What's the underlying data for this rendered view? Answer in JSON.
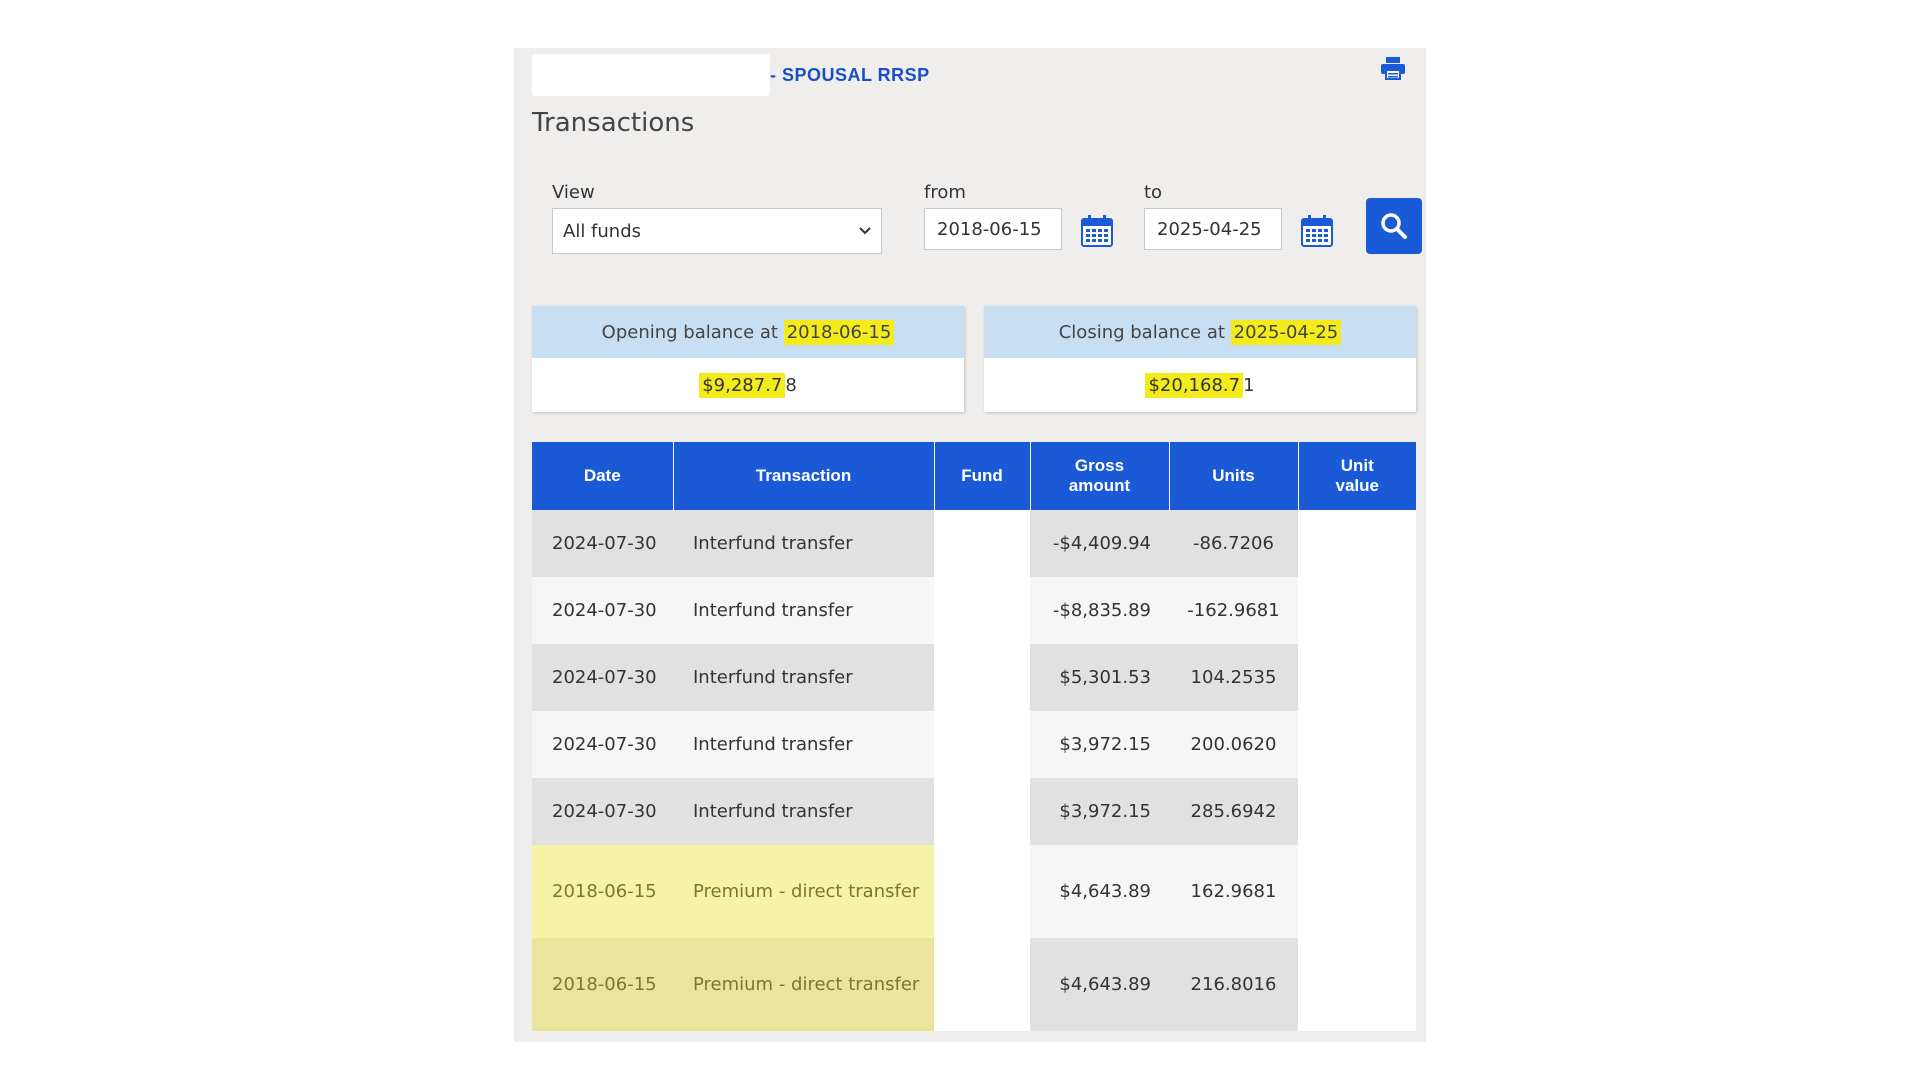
{
  "account": {
    "type_label": "- SPOUSAL RRSP"
  },
  "page": {
    "title": "Transactions"
  },
  "filters": {
    "view_label": "View",
    "view_value": "All funds",
    "from_label": "from",
    "from_value": "2018-06-15",
    "to_label": "to",
    "to_value": "2025-04-25"
  },
  "balances": {
    "opening": {
      "label": "Opening balance at ",
      "date": "2018-06-15",
      "amount_highlighted": "$9,287.7",
      "amount_rest": "8"
    },
    "closing": {
      "label": "Closing balance at ",
      "date": "2025-04-25",
      "amount_highlighted": "$20,168.7",
      "amount_rest": "1"
    }
  },
  "table": {
    "headers": {
      "date": "Date",
      "transaction": "Transaction",
      "fund": "Fund",
      "gross_line1": "Gross",
      "gross_line2": "amount",
      "units": "Units",
      "unit_value_line1": "Unit",
      "unit_value_line2": "value"
    },
    "rows": [
      {
        "date": "2024-07-30",
        "transaction": "Interfund transfer",
        "gross": "-$4,409.94",
        "units": "-86.7206"
      },
      {
        "date": "2024-07-30",
        "transaction": "Interfund transfer",
        "gross": "-$8,835.89",
        "units": "-162.9681"
      },
      {
        "date": "2024-07-30",
        "transaction": "Interfund transfer",
        "gross": "$5,301.53",
        "units": "104.2535"
      },
      {
        "date": "2024-07-30",
        "transaction": "Interfund transfer",
        "gross": "$3,972.15",
        "units": "200.0620"
      },
      {
        "date": "2024-07-30",
        "transaction": "Interfund transfer",
        "gross": "$3,972.15",
        "units": "285.6942"
      },
      {
        "date": "2018-06-15",
        "transaction": "Premium - direct transfer",
        "gross": "$4,643.89",
        "units": "162.9681"
      },
      {
        "date": "2018-06-15",
        "transaction": "Premium - direct transfer",
        "gross": "$4,643.89",
        "units": "216.8016"
      }
    ]
  },
  "colors": {
    "accent": "#1a5ad7",
    "highlight": "#f3ec1a",
    "header_bg": "#c8def2"
  },
  "icons": {
    "print": "printer-icon",
    "calendar": "calendar-icon",
    "search": "search-icon",
    "select": "chevron-down-icon"
  }
}
